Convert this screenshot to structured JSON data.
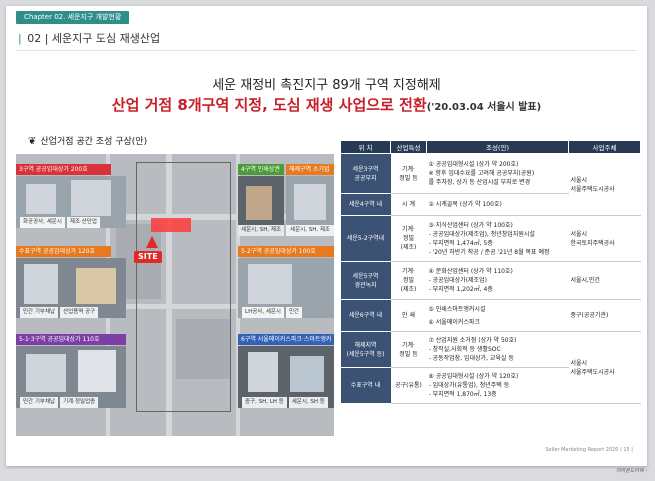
{
  "header": {
    "chapter_tag": "Chapter 02. 세운지구 개발현황",
    "section_bar": "|",
    "section_title": "02 | 세운지구 도심 재생산업"
  },
  "headline": {
    "line1": "세운 재정비 촉진지구 89개 구역 지정해제",
    "line2_main": "산업 거점 8개구역 지정, 도심 재생 사업으로 전환",
    "line2_sub": "('20.03.04 서울시 발표)"
  },
  "map": {
    "heading": "산업거점 공간 조성 구상(안)",
    "leaf_icon": "leaf-icon",
    "callouts": {
      "area3": "3구역 공공임대상가 200호",
      "area4": "4구역 인쇄상권",
      "skill": "해제구역 소기업",
      "area6": "수표구역 공공임대상가 120호",
      "area52": "5-2구역 공공임대상가 100호",
      "area51": "5-1·3구역 공공임대상가 110호",
      "area6b": "6구역 서울메이커스파크·스마트앵커"
    },
    "photo_labels": {
      "p1a": "화공공사, 세운시",
      "p1b": "제조·산단업",
      "p2a": "세운시, SH, 제조",
      "p2b": "세운시, SH, 제조",
      "p3a": "민간 기부채납",
      "p3b": "산업용역 공구",
      "p4a": "LH공사, 세운시",
      "p4b": "민간",
      "p5a": "민간 기부채납",
      "p5b": "기계·정밀업종",
      "p6a": "중구, SH, LH 등",
      "p6b": "세운시, SH 등"
    },
    "site_label": "SITE"
  },
  "table": {
    "headers": [
      "위 치",
      "산업특성",
      "조성(안)",
      "사업주체"
    ],
    "rows": [
      {
        "pos": [
          "세운3구역",
          "공공부지"
        ],
        "trait": [
          "기계·",
          "정밀 등"
        ],
        "plan": [
          "① 공공임대형시설 (상가 약 200호)",
          "※ 향후 임대수요를 고려해 공공부지(공원)",
          "   를 주차장, 상가 등 산업시설 부지로 변경"
        ],
        "org": [
          "서울시",
          "서울주택도시공사"
        ]
      },
      {
        "pos": [
          "세운4구역 내"
        ],
        "trait": [
          "시 계"
        ],
        "plan": [
          "② 시계골목 (상가 약 100호)"
        ],
        "org": []
      },
      {
        "pos": [
          "세운5-2구역내"
        ],
        "trait": [
          "기계·",
          "정밀",
          "(제조)"
        ],
        "plan": [
          "③ 지식산업센터 (상가 약 100호)",
          "- 공공임대상가(제조업), 청년창업지원시설",
          "- 부지면적 1,474㎡, 5층",
          "- '20년 하반기 착공 / 준공 '21년 8월 목표 예정"
        ],
        "org": [
          "서울시",
          "한국토지주택공사"
        ]
      },
      {
        "pos": [
          "세운5구역",
          "경관녹지"
        ],
        "trait": [
          "기계·",
          "정밀",
          "(제조)"
        ],
        "plan": [
          "④ 문화산업센터 (상가 약 110호)",
          "- 공공임대상가(제조업)",
          "- 부지면적 1,202㎡, 4층"
        ],
        "org": [
          "서울시,민간"
        ]
      },
      {
        "pos": [
          "세운6구역 내"
        ],
        "trait": [
          "인 쇄"
        ],
        "plan": [
          "⑤ 인쇄스마트앵커시설",
          "⑥ 서울메이커스파크"
        ],
        "org": [
          "중구(공공기관)"
        ]
      },
      {
        "pos": [
          "해제지역",
          "(세운5구역 등)"
        ],
        "trait": [
          "기계·",
          "정밀 등"
        ],
        "plan": [
          "⑦ 산업지원 소거점 (상가 약 50호)",
          "- 창작실,사회적 등 생활SOC",
          "- 공동작업장, 임대상가, 교육실 등"
        ],
        "org": [
          "서울시",
          "서울주택도시공사"
        ]
      },
      {
        "pos": [
          "수표구역 내"
        ],
        "trait": [
          "공구(유통)"
        ],
        "plan": [
          "⑧ 공공임대형시설 (상가 약 120호)",
          "- 임대상가(유통업), 청년주택 등",
          "- 부지면적 1,870㎡, 13층"
        ],
        "org": []
      }
    ]
  },
  "footer": {
    "text": "Soller Marketing Report 2020 | 15 |",
    "signature": "리바운드어택 -"
  },
  "colors": {
    "accent_teal": "#2f8e8a",
    "headline_red": "#c81e28",
    "table_header": "#263a56",
    "table_pos": "#3b5275"
  }
}
